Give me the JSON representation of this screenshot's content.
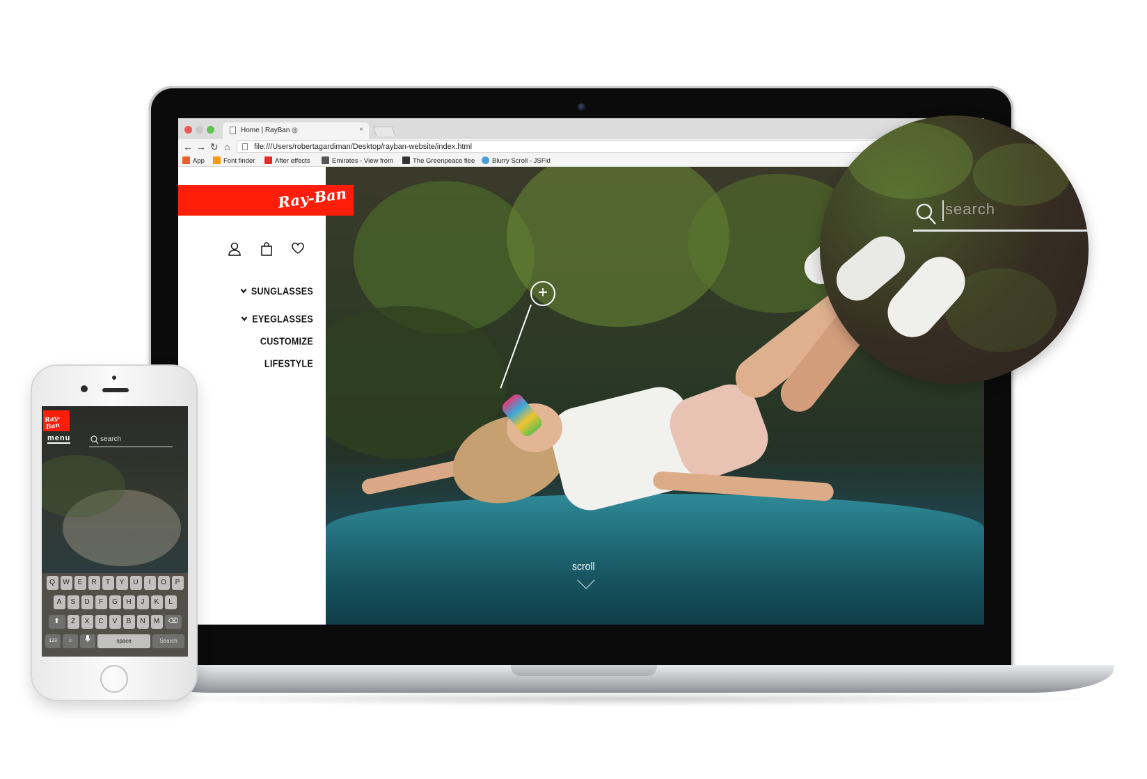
{
  "browser": {
    "tab_title": "Home | RayBan ◎",
    "tab_close": "×",
    "url": "file:///Users/robertagardiman/Desktop/rayban-website/index.html",
    "bookmarks": [
      {
        "label": "App",
        "icon": "apps-grid-icon",
        "color": "#e8612c"
      },
      {
        "label": "Font finder",
        "icon": "font-finder-icon",
        "color": "#f39c12"
      },
      {
        "label": "After effects",
        "icon": "youtube-icon",
        "color": "#e52d27"
      },
      {
        "label": "Emirates - View from",
        "icon": "emirates-icon",
        "color": "#555555"
      },
      {
        "label": "The Greenpeace flee",
        "icon": "greenpeace-icon",
        "color": "#333333"
      },
      {
        "label": "Blurry Scroll - JSFid",
        "icon": "cloud-icon",
        "color": "#4a9fd8"
      }
    ]
  },
  "site": {
    "logo": "Ray-Ban",
    "nav": [
      {
        "label": "SUNGLASSES",
        "has_caret": true
      },
      {
        "label": "EYEGLASSES",
        "has_caret": true
      },
      {
        "label": "CUSTOMIZE",
        "has_caret": false
      },
      {
        "label": "LIFESTYLE",
        "has_caret": false
      }
    ],
    "plus_marker": "+",
    "scroll_label": "scroll",
    "search_placeholder": "search",
    "brand_color": "#ff1e0a"
  },
  "phone": {
    "logo": "Ray-Ban",
    "menu_label": "menu",
    "search_placeholder": "search",
    "keyboard": {
      "row1": [
        "Q",
        "W",
        "E",
        "R",
        "T",
        "Y",
        "U",
        "I",
        "O",
        "P"
      ],
      "row2": [
        "A",
        "S",
        "D",
        "F",
        "G",
        "H",
        "J",
        "K",
        "L"
      ],
      "row3": [
        "Z",
        "X",
        "C",
        "V",
        "B",
        "N",
        "M"
      ],
      "shift": "⬆",
      "backspace": "⌫",
      "numbers": "123",
      "emoji": "☺",
      "mic": "🎤",
      "space": "space",
      "search": "Search"
    }
  }
}
